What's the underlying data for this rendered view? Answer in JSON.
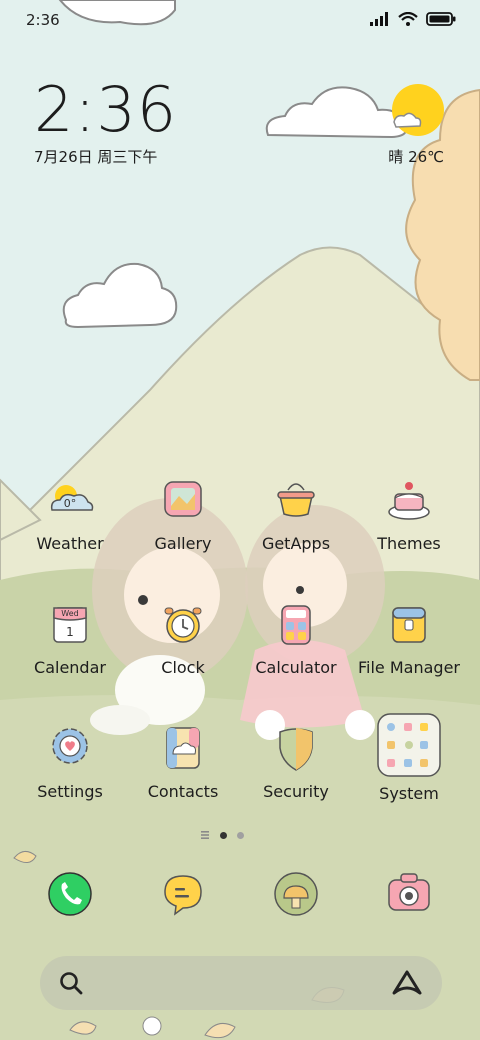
{
  "status_bar": {
    "time": "2:36"
  },
  "clock_widget": {
    "time": "2:36",
    "date": "7月26日 周三下午",
    "weather": "晴 26℃"
  },
  "apps": [
    {
      "label": "Weather",
      "icon": "weather-icon",
      "temp": "0°"
    },
    {
      "label": "Gallery",
      "icon": "gallery-icon"
    },
    {
      "label": "GetApps",
      "icon": "getapps-icon"
    },
    {
      "label": "Themes",
      "icon": "themes-icon"
    },
    {
      "label": "Calendar",
      "icon": "calendar-icon",
      "day": "Wed",
      "date": "1"
    },
    {
      "label": "Clock",
      "icon": "clock-icon"
    },
    {
      "label": "Calculator",
      "icon": "calculator-icon"
    },
    {
      "label": "File Manager",
      "icon": "file-manager-icon"
    },
    {
      "label": "Settings",
      "icon": "settings-icon"
    },
    {
      "label": "Contacts",
      "icon": "contacts-icon"
    },
    {
      "label": "Security",
      "icon": "security-icon"
    },
    {
      "label": "System",
      "icon": "system-folder-icon"
    }
  ],
  "pager": {
    "pages": 2,
    "current": 1
  },
  "dock": [
    {
      "icon": "phone-icon"
    },
    {
      "icon": "messages-icon"
    },
    {
      "icon": "browser-icon"
    },
    {
      "icon": "camera-icon"
    }
  ],
  "colors": {
    "sky": "#e3f1ee",
    "mountain": "#e9ead0",
    "grass": "#c9d3a8",
    "sun": "#ffd21e",
    "tree": "#f7ddb0"
  }
}
